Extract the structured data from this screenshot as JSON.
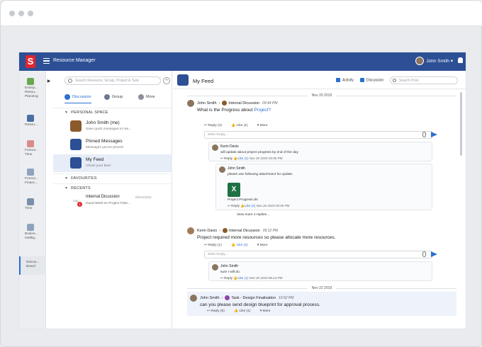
{
  "app": {
    "title": "Resource Manager",
    "logo": "S",
    "user": "John Smith",
    "user_caret": "▾"
  },
  "rail": [
    {
      "label": "Enterp... Resou... Planning",
      "icon": "enterprise-planning-icon",
      "color": "#6aa84f"
    },
    {
      "label": "Resou...",
      "icon": "resource-icon",
      "color": "#4a6fa5"
    },
    {
      "label": "Foreca... Time",
      "icon": "forecast-time-icon",
      "color": "#d98c8c"
    },
    {
      "label": "Foreca... Financ...",
      "icon": "forecast-finance-icon",
      "color": "#8fa3bf"
    },
    {
      "label": "Time",
      "icon": "time-icon",
      "color": "#7a8fa8"
    },
    {
      "label": "Busine... Intellig...",
      "icon": "business-intelligence-icon",
      "color": "#8fa3bf"
    },
    {
      "label": "Discus... Board",
      "icon": "discussion-board-icon",
      "color": "#2c6fd1"
    }
  ],
  "mid": {
    "search_placeholder": "Search Resource, Group, Project & Task",
    "tabs": [
      "Discussion",
      "Group",
      "More"
    ],
    "personal_space": "PERSONAL SPACE",
    "favourites": "FAVOURITES",
    "recents": "RECENTS",
    "convos": [
      {
        "title": "John Smith (me)",
        "sub": "Save quick messages to rea..."
      },
      {
        "title": "Pinned Messages",
        "sub": "Messages you've pinned"
      },
      {
        "title": "My Feed",
        "sub": "Check your feed"
      }
    ],
    "recent": {
      "title": "Internal Dicussion",
      "date": "09/10/2020",
      "sub": "Good Work on Project Train...",
      "img": "img",
      "badge": "1"
    }
  },
  "feed": {
    "title": "My Feed",
    "activity": "Activity",
    "discussion": "Discussion",
    "search_placeholder": "Search Post",
    "date1": "Nov 20 2019",
    "date2": "Nov 22 2019",
    "reply_placeholder": "Write Reply...",
    "posts": [
      {
        "author": "John Smith",
        "target": "Internal Dicussion",
        "time": "09:44 PM",
        "body": "What is the Progress about ",
        "link": "Project?",
        "actions": [
          "Reply (4)",
          "Like (1)",
          "More"
        ]
      },
      {
        "author": "Kerin Davis",
        "target": "Internal Dicussion",
        "time": "09:12 PM",
        "body": "Project   required more resources so   please allocate more resources.",
        "actions": [
          "Reply (1)",
          "Like (2)",
          "More"
        ]
      },
      {
        "author": "John Smith",
        "target": "Task - Design Finalisation",
        "time": "10:52 PM",
        "body": "can you please send design blueprint for approval process.",
        "actions": [
          "Reply (6)",
          "Like (1)",
          "More"
        ]
      }
    ],
    "replies": [
      {
        "name": "Kerin Davis",
        "body": "will update about   project progress by end of the day",
        "reply": "Reply",
        "like": "Like (1)",
        "time": "Nov 20 2019 03:55 PM"
      },
      {
        "name": "John Smith",
        "body": "please use following attachment for update.",
        "file": "Project Progress.xls",
        "reply": "Reply",
        "like": "Like (2)",
        "time": "Nov 20 2019 03:55 PM"
      },
      {
        "name": "John Smith",
        "body": "sure I will do.",
        "reply": "Reply",
        "like": "Like (1)",
        "time": "Nov 20 2019 06:13 PM"
      }
    ],
    "view_more": "View more 2 replies..."
  }
}
